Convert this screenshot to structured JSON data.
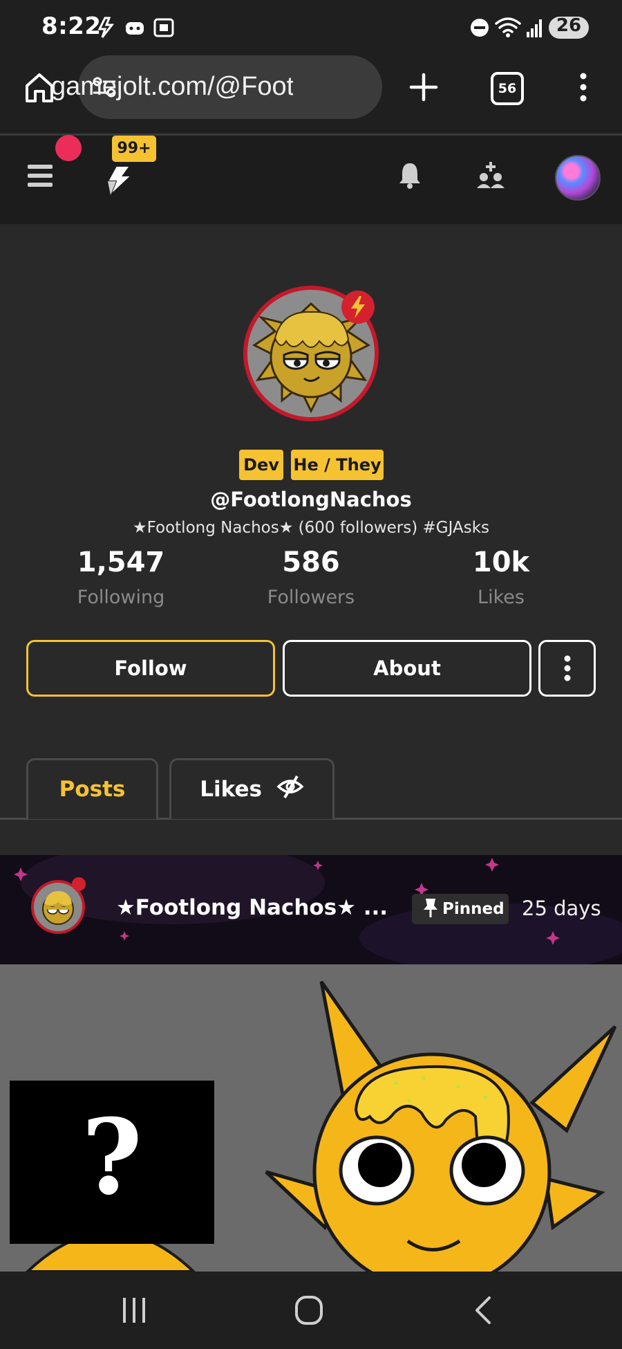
{
  "status_bar": {
    "time": "8:22",
    "battery": "26"
  },
  "browser": {
    "url": "gamejolt.com/@FootlongNachos",
    "tab_count": "56"
  },
  "app_header": {
    "notification_badge": "99+"
  },
  "profile": {
    "tags": [
      "Dev",
      "He / They"
    ],
    "username": "@FootlongNachos",
    "bio": "★Footlong Nachos★ (600 followers) #GJAsks",
    "stats": [
      {
        "value": "1,547",
        "label": "Following"
      },
      {
        "value": "586",
        "label": "Followers"
      },
      {
        "value": "10k",
        "label": "Likes"
      }
    ],
    "buttons": {
      "follow": "Follow",
      "about": "About"
    }
  },
  "tabs": [
    {
      "label": "Posts",
      "active": true
    },
    {
      "label": "Likes",
      "active": false
    }
  ],
  "post": {
    "title": "★Footlong Nachos★ ...",
    "pinned_label": "Pinned",
    "time": "25 days",
    "image_overlay_text": "?"
  },
  "colors": {
    "accent": "#f5c232",
    "notification_dot": "#ec2d5a",
    "avatar_ring": "#c4192b"
  }
}
